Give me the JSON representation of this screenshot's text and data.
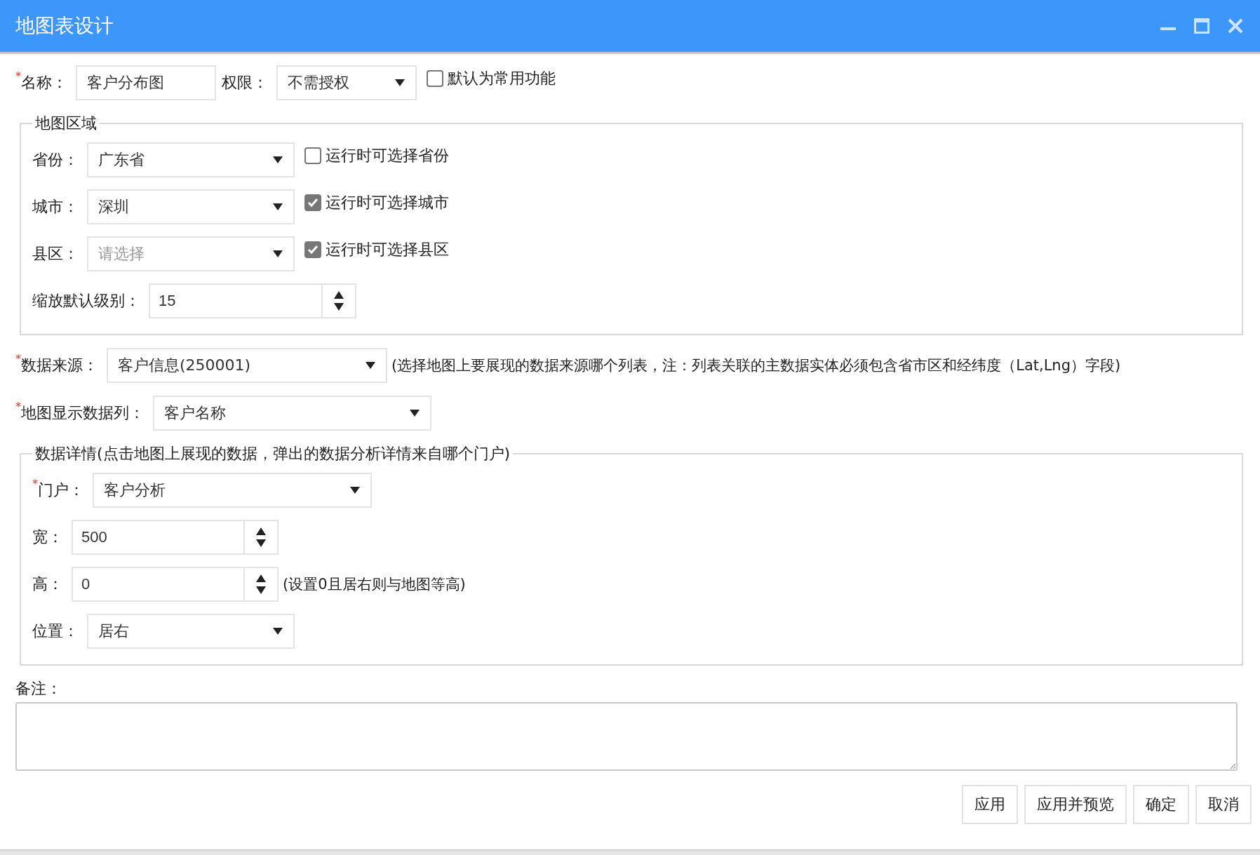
{
  "window": {
    "title": "地图表设计"
  },
  "top_row": [
    {
      "kind": "text",
      "required_mark": "*",
      "label": "名称：",
      "value": "客户分布图"
    },
    {
      "kind": "select",
      "label": "权限：",
      "value": "不需授权"
    },
    {
      "kind": "checkbox",
      "label": "默认为常用功能",
      "checked": false
    }
  ],
  "map_area": {
    "legend": "地图区域",
    "fields": [
      {
        "kind": "select",
        "label": "省份：",
        "value": "广东省",
        "option": {
          "label": "运行时可选择省份",
          "checked": false
        }
      },
      {
        "kind": "select",
        "label": "城市：",
        "value": "深圳",
        "option": {
          "label": "运行时可选择城市",
          "checked": true
        }
      },
      {
        "kind": "select",
        "label": "县区：",
        "placeholder": "请选择",
        "option": {
          "label": "运行时可选择县区",
          "checked": true
        }
      },
      {
        "kind": "spinner",
        "label": "缩放默认级别：",
        "value": "15"
      }
    ]
  },
  "data_source": {
    "required_mark": "*",
    "label": "数据来源：",
    "value": "客户信息(250001)",
    "note": "(选择地图上要展现的数据来源哪个列表，注：列表关联的主数据实体必须包含省市区和经纬度（Lat,Lng）字段)"
  },
  "display_column": {
    "required_mark": "*",
    "label": "地图显示数据列：",
    "value": "客户名称"
  },
  "detail": {
    "legend": "数据详情(点击地图上展现的数据，弹出的数据分析详情来自哪个门户)",
    "fields": [
      {
        "kind": "select",
        "required_mark": "*",
        "label": "门户：",
        "value": "客户分析"
      },
      {
        "kind": "spinner",
        "label": "宽：",
        "value": "500"
      },
      {
        "kind": "spinner",
        "label": "高：",
        "value": "0",
        "note": "(设置0且居右则与地图等高)"
      },
      {
        "kind": "select",
        "label": "位置：",
        "value": "居右"
      }
    ]
  },
  "remarks": {
    "label": "备注："
  },
  "buttons": [
    "应用",
    "应用并预览",
    "确定",
    "取消"
  ]
}
